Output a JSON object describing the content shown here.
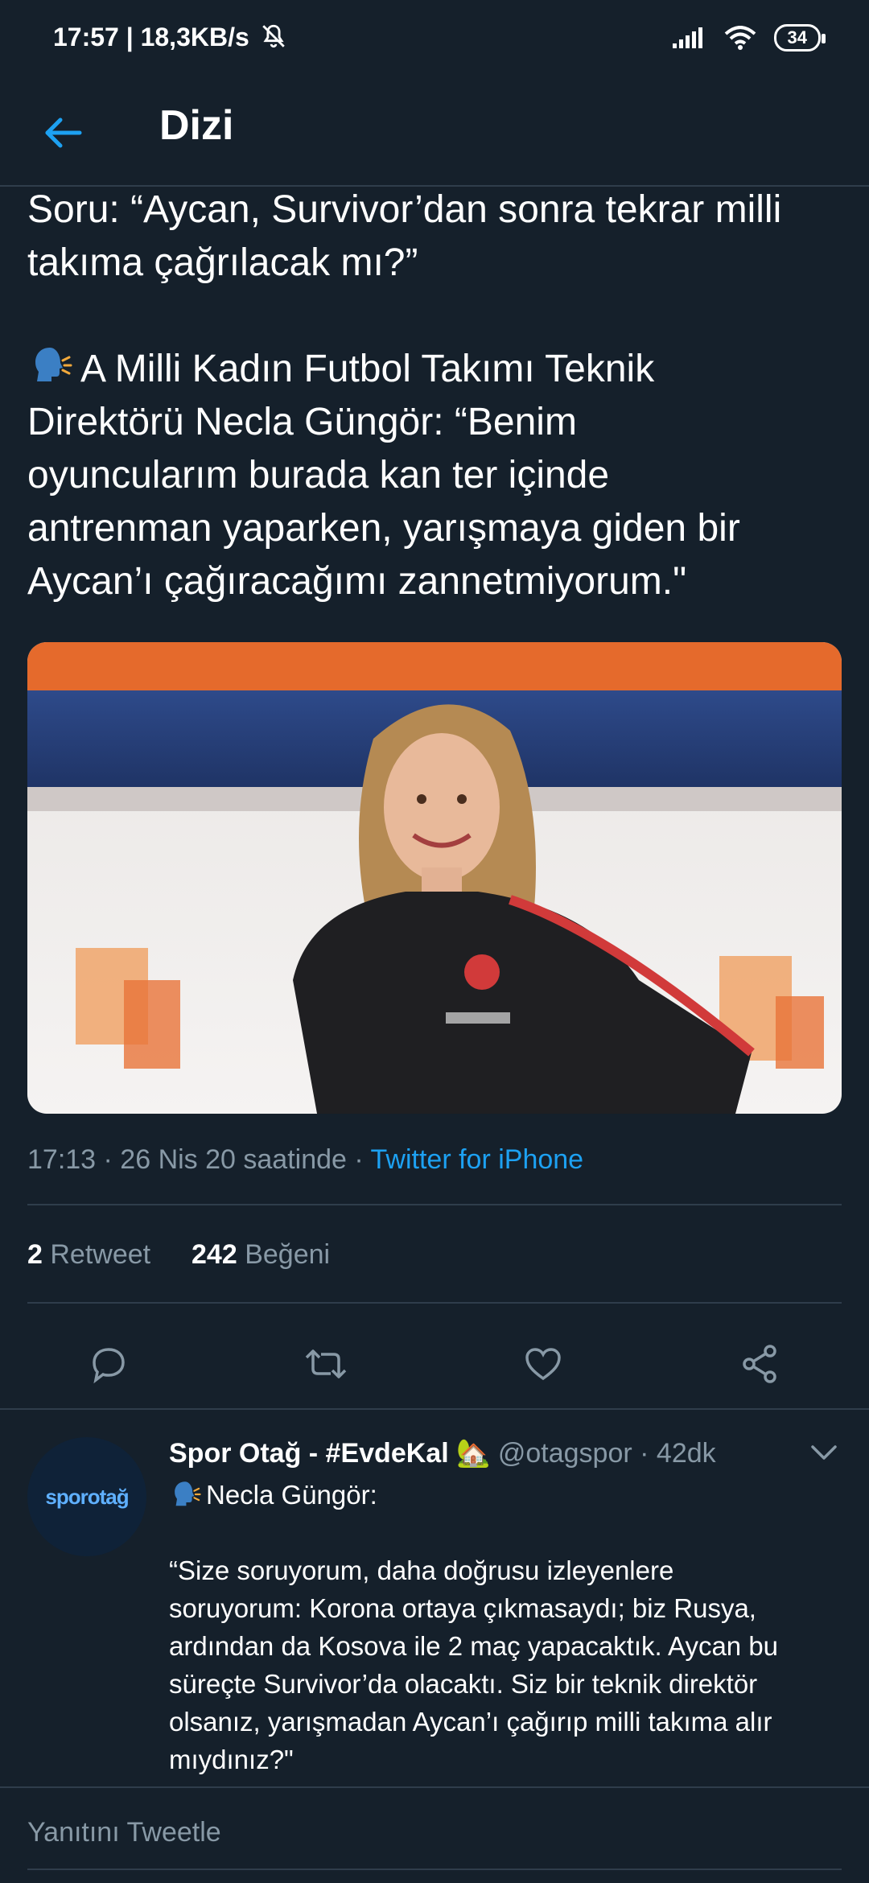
{
  "status_bar": {
    "time_speed": "17:57 | 18,3KB/s",
    "battery": "34"
  },
  "header": {
    "title": "Dizi"
  },
  "tweet": {
    "line1": "Soru: “Aycan, Survivor’dan sonra tekrar milli",
    "line2": "takıma çağrılacak mı?”",
    "line3": "A Milli Kadın Futbol Takımı Teknik",
    "line4": "Direktörü Necla Güngör: “Benim",
    "line5": "oyuncularım burada kan ter içinde",
    "line6": "antrenman yaparken, yarışmaya giden bir",
    "line7": "Aycan’ı çağıracağımı zannetmiyorum.\"",
    "meta_time": "17:13 · 26 Nis 20 saatinde · ",
    "meta_source": "Twitter for iPhone",
    "retweet_count": "2",
    "retweet_label": "Retweet",
    "like_count": "242",
    "like_label": "Beğeni"
  },
  "reply": {
    "avatar_text": "sporotağ",
    "name": "Spor Otağ - #EvdeKal 🏡",
    "handle": " @otagspor · 42dk",
    "line1": "Necla Güngör:",
    "line2": "“Size soruyorum, daha doğrusu izleyenlere",
    "line3": "soruyorum: Korona ortaya çıkmasaydı; biz Rusya,",
    "line4": "ardından da Kosova ile 2 maç yapacaktık. Aycan bu",
    "line5": "süreçte Survivor’da olacaktı. Siz bir teknik direktör",
    "line6": "olsanız, yarışmadan Aycan’ı çağırıp milli takıma alır",
    "line7": "mıydınız?\""
  },
  "reply_input": {
    "placeholder": "Yanıtını Tweetle"
  },
  "colors": {
    "background": "#15202b",
    "accent": "#1da1f2",
    "secondary_text": "#8899a6",
    "divider": "#2f3d4b"
  },
  "icons": [
    "back-arrow-icon",
    "speaking-head-icon",
    "reply-icon",
    "retweet-icon",
    "like-icon",
    "share-icon",
    "chevron-down-icon",
    "signal-icon",
    "wifi-icon",
    "mute-bell-icon"
  ]
}
